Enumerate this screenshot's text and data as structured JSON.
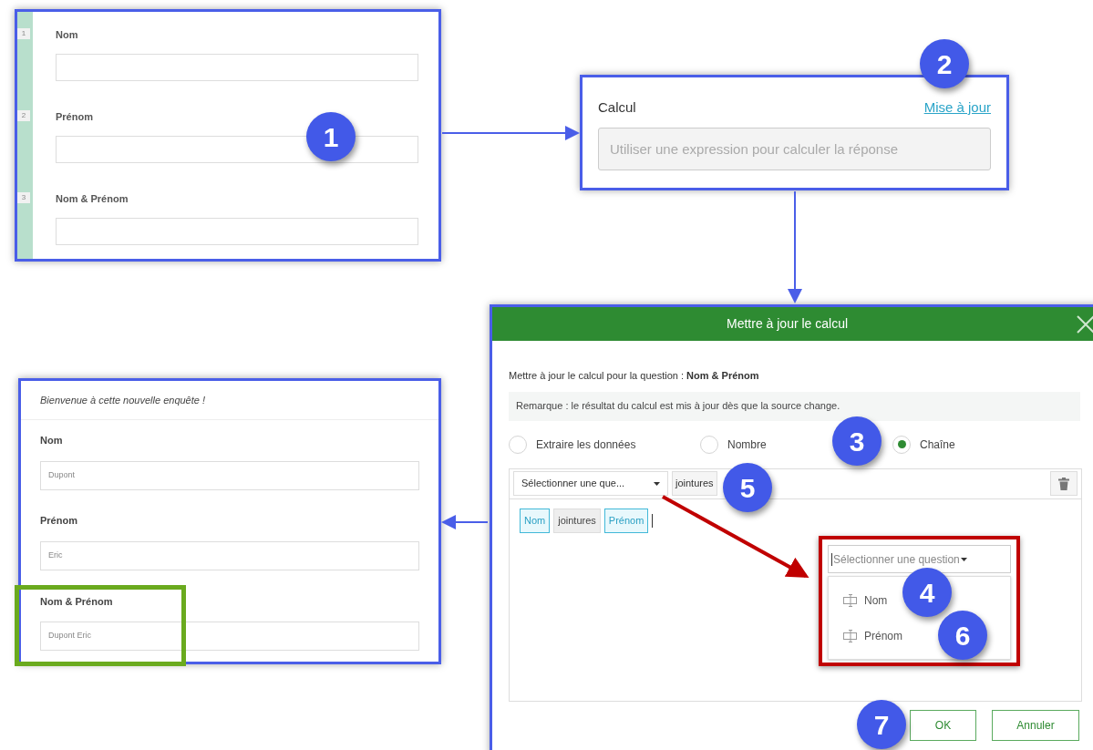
{
  "form_editor": {
    "questions": [
      {
        "number": "1",
        "label": "Nom"
      },
      {
        "number": "2",
        "label": "Prénom"
      },
      {
        "number": "3",
        "label": "Nom & Prénom"
      }
    ]
  },
  "calcul_panel": {
    "title": "Calcul",
    "link": "Mise à jour",
    "placeholder": "Utiliser une expression pour calculer la réponse"
  },
  "dialog": {
    "title": "Mettre à jour le calcul",
    "question_line": "Mettre à jour le calcul pour la question : **Nom & Prénom**",
    "note": "Remarque : le résultat du calcul est mis à jour dès que la source change.",
    "types": [
      {
        "label": "Extraire les données",
        "selected": false
      },
      {
        "label": "Nombre",
        "selected": false
      },
      {
        "label": "Chaîne",
        "selected": true
      }
    ],
    "toolbar": {
      "select": "Sélectionner une que...",
      "join": "jointures"
    },
    "tokens": [
      {
        "label": "Nom",
        "kind": "question"
      },
      {
        "label": "jointures",
        "kind": "join"
      },
      {
        "label": "Prénom",
        "kind": "question"
      }
    ],
    "dropdown": {
      "placeholder": "Sélectionner une question",
      "options": [
        "Nom",
        "Prénom"
      ]
    },
    "buttons": [
      {
        "label": "OK",
        "kind": "primary"
      },
      {
        "label": "Annuler",
        "kind": "secondary"
      }
    ]
  },
  "preview": {
    "welcome": "Bienvenue à cette nouvelle enquête !",
    "fields": [
      {
        "label": "Nom",
        "value": "Dupont",
        "highlighted": false
      },
      {
        "label": "Prénom",
        "value": "Eric",
        "highlighted": false
      },
      {
        "label": "Nom & Prénom",
        "value": "Dupont Eric",
        "highlighted": true
      }
    ]
  },
  "steps": [
    "1",
    "2",
    "3",
    "4",
    "5",
    "6",
    "7"
  ]
}
